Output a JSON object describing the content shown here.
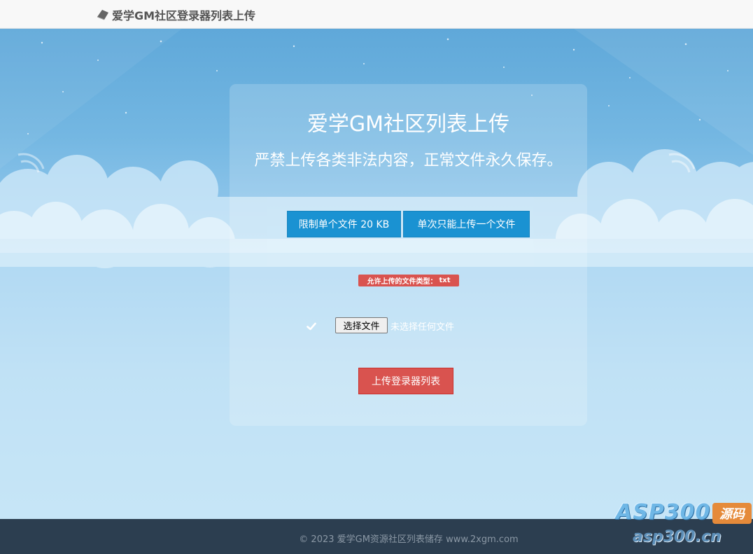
{
  "navbar": {
    "brand_label": "爱学GM社区登录器列表上传",
    "brand_icon": "leaf-icon"
  },
  "card": {
    "title": "爱学GM社区列表上传",
    "subtitle": "严禁上传各类非法内容，正常文件永久保存。",
    "limit_size_label": "限制单个文件 20 KB",
    "limit_count_label": "单次只能上传一个文件",
    "allowed_types_label": "允许上传的文件类型：",
    "allowed_types_value": "txt",
    "file_choose_label": "选择文件",
    "file_status": "未选择任何文件",
    "upload_button_label": "上传登录器列表"
  },
  "footer": {
    "copyright": "© 2023 爱学GM资源社区列表储存 www.2xgm.com"
  },
  "watermark": {
    "top_text": "ASP300",
    "badge_text": "源码",
    "bottom_text": "asp300.cn"
  },
  "colors": {
    "info": "#1a92d2",
    "danger": "#d9534f",
    "footer_bg": "#2c3e50",
    "navbar_bg": "#f8f8f8"
  }
}
